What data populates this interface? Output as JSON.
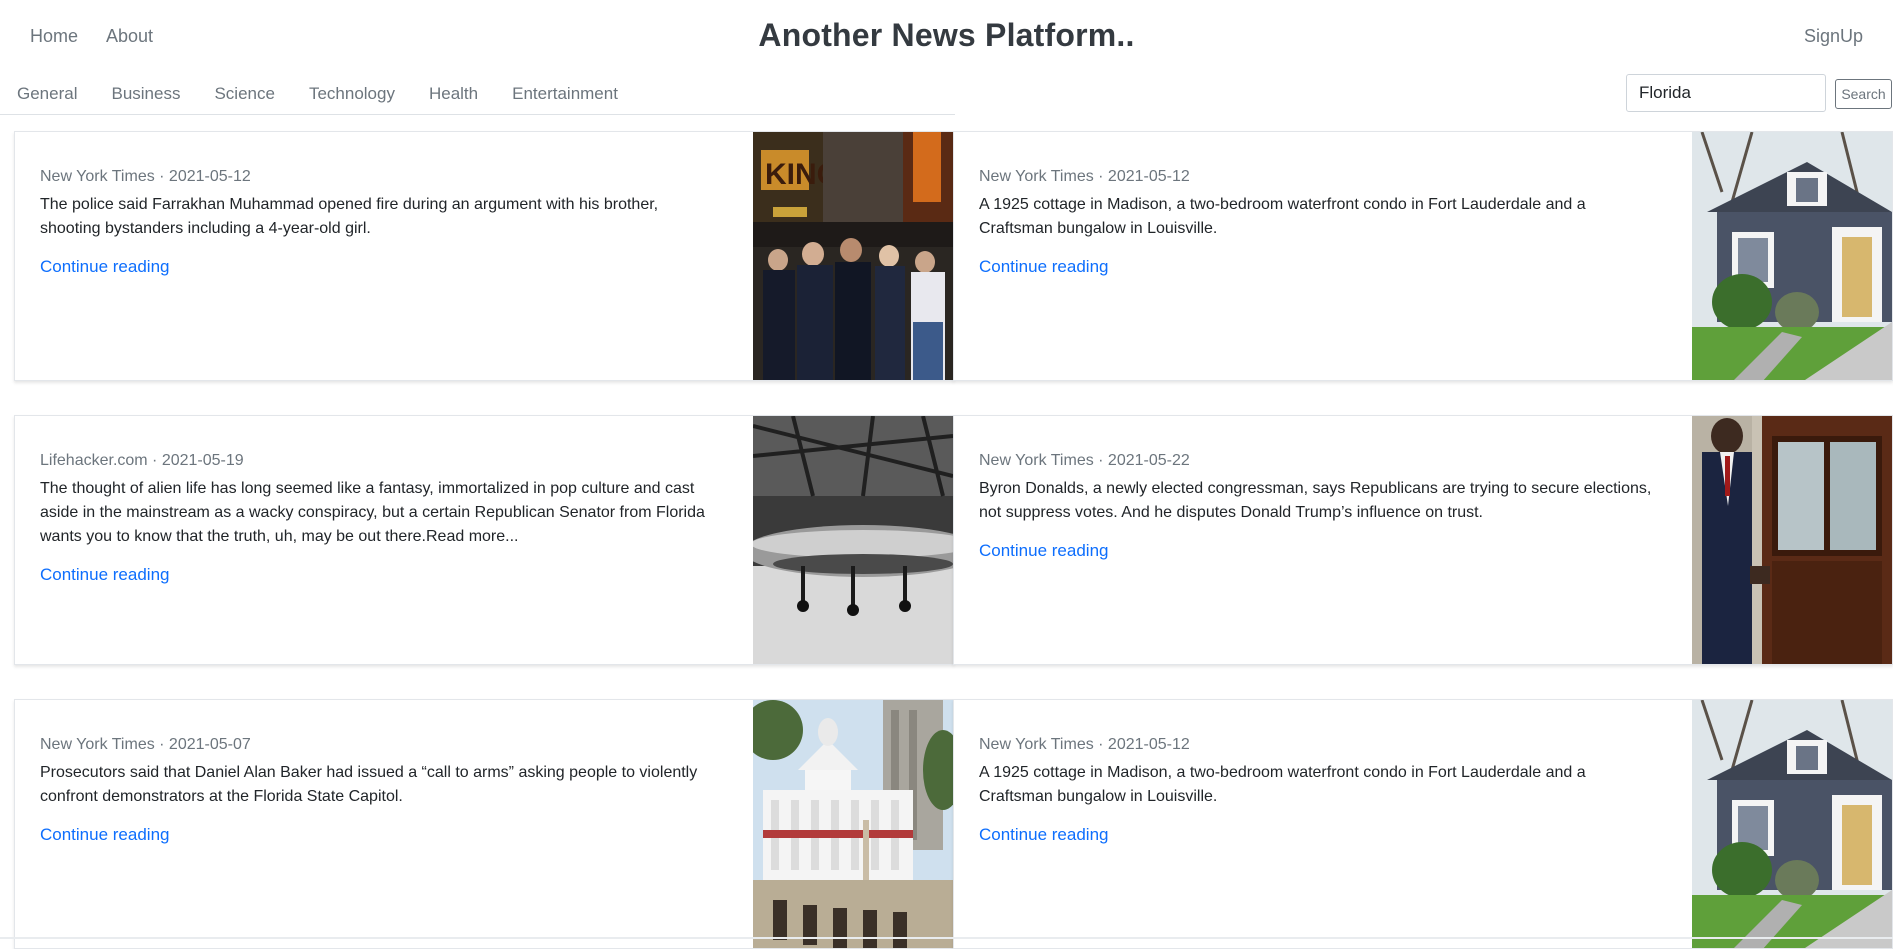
{
  "nav": {
    "links": [
      "Home",
      "About"
    ],
    "brand": "Another News Platform..",
    "signup": "SignUp"
  },
  "categories": [
    "General",
    "Business",
    "Science",
    "Technology",
    "Health",
    "Entertainment"
  ],
  "search": {
    "value": "Florida",
    "button": "Search"
  },
  "articles": [
    {
      "meta": "New York Times · 2021-05-12",
      "summary": "The police said Farrakhan Muhammad opened fire during an argument with his brother, shooting bystanders including a 4-year-old girl.",
      "link": "Continue reading",
      "image": "police-street-scene"
    },
    {
      "meta": "New York Times · 2021-05-12",
      "summary": "A 1925 cottage in Madison, a two-bedroom waterfront condo in Fort Lauderdale and a Craftsman bungalow in Louisville.",
      "link": "Continue reading",
      "image": "gray-cottage-house"
    },
    {
      "meta": "Lifehacker.com · 2021-05-19",
      "summary": "The thought of alien life has long seemed like a fantasy, immortalized in pop culture and cast aside in the mainstream as a wacky conspiracy, but a certain Republican Senator from Florida wants you to know that the truth, uh, may be out there.Read more...",
      "link": "Continue reading",
      "image": "flying-saucer-bw"
    },
    {
      "meta": "New York Times · 2021-05-22",
      "summary": "Byron Donalds, a newly elected congressman, says Republicans are trying to secure elections, not suppress votes. And he disputes Donald Trump’s influence on trust.",
      "link": "Continue reading",
      "image": "congressman-portrait"
    },
    {
      "meta": "New York Times · 2021-05-07",
      "summary": "Prosecutors said that Daniel Alan Baker had issued a “call to arms” asking people to violently confront demonstrators at the Florida State Capitol.",
      "link": "Continue reading",
      "image": "florida-capitol"
    },
    {
      "meta": "New York Times · 2021-05-12",
      "summary": "A 1925 cottage in Madison, a two-bedroom waterfront condo in Fort Lauderdale and a Craftsman bungalow in Louisville.",
      "link": "Continue reading",
      "image": "gray-cottage-house"
    }
  ]
}
